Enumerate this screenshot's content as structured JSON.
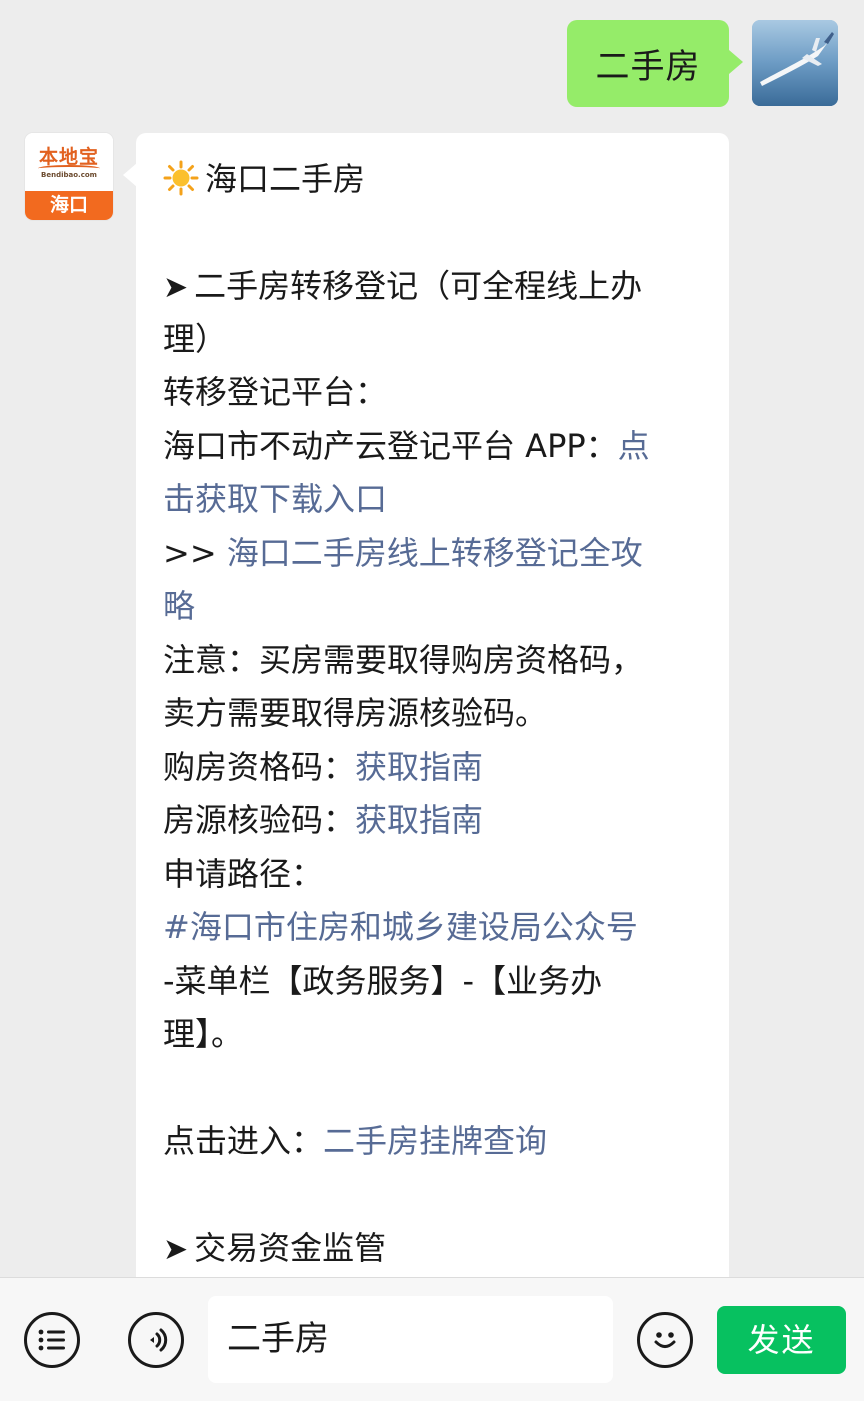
{
  "colors": {
    "outgoing_bubble": "#95ec69",
    "link": "#576b95",
    "send_button": "#07c160",
    "logo_orange": "#f26a1f"
  },
  "outgoing": {
    "text": "二手房",
    "avatar_icon": "airplane-photo-avatar"
  },
  "account": {
    "logo_text": "本地宝",
    "logo_url": "Bendibao.com",
    "city": "海口"
  },
  "incoming": {
    "title_icon": "sun-icon",
    "title": "海口二手房",
    "section1_heading_1": "二手房转移登记（可全程线上办",
    "section1_heading_2": "理）",
    "platform_label": "转移登记平台：",
    "app_line": "海口市不动产云登记平台 APP：",
    "app_link_1": "点",
    "app_link_2": "击获取下载入口",
    "guide_prefix": ">>",
    "guide_link_1": "海口二手房线上转移登记全攻",
    "guide_link_2": "略",
    "note_1": "注意：买房需要取得购房资格码，",
    "note_2": "卖方需要取得房源核验码。",
    "qual_label": "购房资格码：",
    "qual_link": "获取指南",
    "verify_label": "房源核验码：",
    "verify_link": "获取指南",
    "path_label": "申请路径：",
    "path_link": "#海口市住房和城乡建设局公众号",
    "path_text_1": "-菜单栏【政务服务】-【业务办",
    "path_text_2": "理】。",
    "enter_label": "点击进入：",
    "enter_link": "二手房挂牌查询",
    "section2_heading": "交易资金监管"
  },
  "input_bar": {
    "menu_icon": "list-menu-icon",
    "voice_icon": "voice-icon",
    "input_value": "二手房",
    "emoji_icon": "smiley-icon",
    "send_label": "发送"
  }
}
